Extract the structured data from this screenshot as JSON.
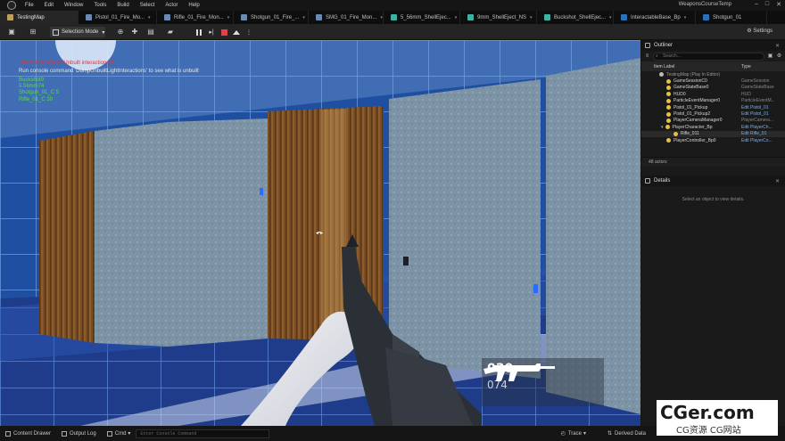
{
  "menu": {
    "items": [
      "File",
      "Edit",
      "Window",
      "Tools",
      "Build",
      "Select",
      "Actor",
      "Help"
    ],
    "project_title": "WeaponsCourseTemp"
  },
  "tabs": [
    {
      "label": "TestingMap",
      "kind": "map",
      "active": true
    },
    {
      "label": "Pistol_01_Fire_Mo...",
      "kind": "asset"
    },
    {
      "label": "Rifle_01_Fire_Mon...",
      "kind": "asset"
    },
    {
      "label": "Shotgun_01_Fire_...",
      "kind": "asset"
    },
    {
      "label": "SMG_01_Fire_Mon...",
      "kind": "asset"
    },
    {
      "label": "5_56mm_ShellEjec...",
      "kind": "ns"
    },
    {
      "label": "9mm_ShellEject_NS",
      "kind": "ns"
    },
    {
      "label": "Buckshot_ShellEjec...",
      "kind": "ns"
    },
    {
      "label": "InteractableBase_Bp",
      "kind": "bp"
    },
    {
      "label": "Shotgun_01",
      "kind": "bp"
    }
  ],
  "toolbar": {
    "mode_label": "Selection Mode",
    "settings_label": "Settings"
  },
  "viewport": {
    "debug_red": "Interaction with an Unbuilt interactions!!!",
    "debug_white": "Run console command 'DumpUnbuiltLightInteractions' to see what is unbuilt",
    "debug_green_1": "Buckshot0",
    "debug_green_2": "5.56mm74",
    "debug_green_3": "Shotgun_01_C 5",
    "debug_green_4": "Rifle_01_C 30",
    "ammo_current": "030",
    "ammo_reserve": "074"
  },
  "outliner": {
    "title": "Outliner",
    "search_placeholder": "Search...",
    "col_label": "Item Label",
    "col_type": "Type",
    "rows": [
      {
        "label": "TestingMap (Play In Editor)",
        "type": ""
      },
      {
        "label": "GameSessionC0",
        "type": "GameSession"
      },
      {
        "label": "GameStateBase0",
        "type": "GameStateBase"
      },
      {
        "label": "HUD0",
        "type": "HUD"
      },
      {
        "label": "ParticleEventManager0",
        "type": "ParticleEventM..."
      },
      {
        "label": "Pistol_01_Pickup",
        "type": "Edit Pistol_01"
      },
      {
        "label": "Pistol_01_Pickup2",
        "type": "Edit Pistol_01"
      },
      {
        "label": "PlayerCameraManager0",
        "type": "PlayerCamera..."
      },
      {
        "label": "PlayerCharacter_Bp",
        "type": "Edit PlayerCh..."
      },
      {
        "label": "Rifle_011",
        "type": "Edit Rifle_01"
      },
      {
        "label": "PlayerController_Bp0",
        "type": "Edit PlayerCo..."
      }
    ],
    "actor_count": "48 actors"
  },
  "details": {
    "title": "Details",
    "empty_message": "Select an object to view details."
  },
  "bottom": {
    "content_drawer": "Content Drawer",
    "output_log": "Output Log",
    "cmd": "Cmd",
    "console_placeholder": "Enter Console Command",
    "trace": "Trace",
    "derived_data": "Derived Data"
  },
  "watermark": {
    "main": "CGer.com",
    "sub": "CG资源 CG网站"
  }
}
